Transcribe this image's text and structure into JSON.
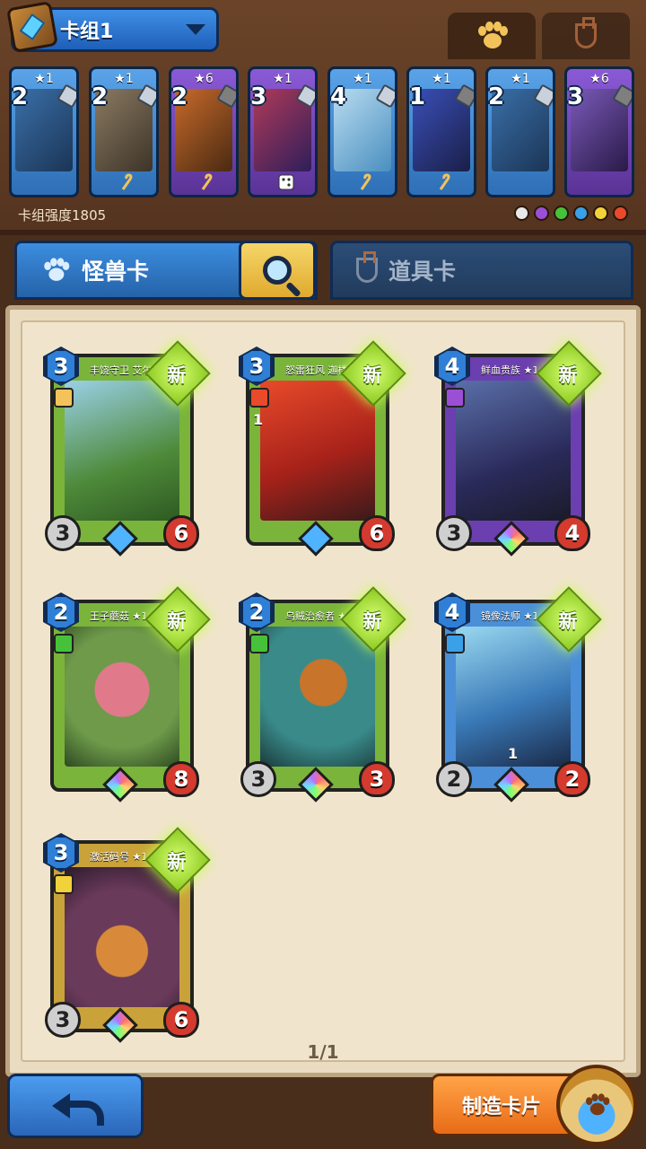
{
  "header": {
    "deck_name": "卡组1",
    "deck_strength": "卡组强度1805",
    "filter_tabs": [
      "monster-paw",
      "item-flask"
    ]
  },
  "deck_cards": [
    {
      "stars": "★1",
      "cost": "2",
      "color": "blue",
      "bottom_icon": "none"
    },
    {
      "stars": "★1",
      "cost": "2",
      "color": "blue",
      "bottom_icon": "cane-icon"
    },
    {
      "stars": "★6",
      "cost": "2",
      "color": "purple",
      "bottom_icon": "cane-icon"
    },
    {
      "stars": "★1",
      "cost": "3",
      "color": "purple",
      "bottom_icon": "dice-icon"
    },
    {
      "stars": "★1",
      "cost": "4",
      "color": "blue",
      "bottom_icon": "cane-icon"
    },
    {
      "stars": "★1",
      "cost": "1",
      "color": "blue",
      "bottom_icon": "cane-icon"
    },
    {
      "stars": "★1",
      "cost": "2",
      "color": "blue",
      "bottom_icon": "none"
    },
    {
      "stars": "★6",
      "cost": "3",
      "color": "purple",
      "bottom_icon": "none"
    }
  ],
  "elements": [
    "#e8e8e8",
    "#9b4fd6",
    "#46c23a",
    "#3aa0e8",
    "#f2d23a",
    "#e84a2a"
  ],
  "category_tabs": {
    "monster": "怪兽卡",
    "item": "道具卡"
  },
  "cards": [
    {
      "name": "丰饶守卫 艾尔莎 ★1",
      "cost": "3",
      "attack": "3",
      "health": "6",
      "new": "新",
      "frame": "green",
      "rarity": "star"
    },
    {
      "name": "怒雷狂风 迦楼罗 ★1",
      "cost": "3",
      "attack": "",
      "health": "6",
      "new": "新",
      "frame": "green",
      "rarity": "star",
      "extra": "1"
    },
    {
      "name": "鲜血贵族 ★1",
      "cost": "4",
      "attack": "3",
      "health": "4",
      "new": "新",
      "frame": "purple",
      "rarity": "rainbow"
    },
    {
      "name": "王子蘑菇 ★1",
      "cost": "2",
      "attack": "",
      "health": "8",
      "new": "新",
      "frame": "green",
      "rarity": "rainbow"
    },
    {
      "name": "乌贼治愈者 ★1",
      "cost": "2",
      "attack": "3",
      "health": "3",
      "new": "新",
      "frame": "blue",
      "rarity": "rainbow"
    },
    {
      "name": "镜像法师 ★1",
      "cost": "4",
      "attack": "2",
      "health": "2",
      "new": "新",
      "frame": "blue",
      "rarity": "rainbow",
      "extra": "1"
    },
    {
      "name": "激活码号 ★1",
      "cost": "3",
      "attack": "3",
      "health": "6",
      "new": "新",
      "frame": "gold",
      "rarity": "rainbow"
    }
  ],
  "pagination": "1/1",
  "bottom": {
    "craft_label": "制造卡片"
  }
}
